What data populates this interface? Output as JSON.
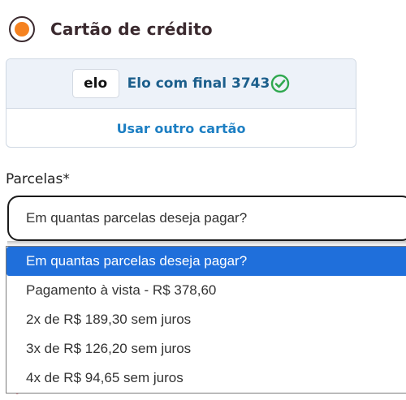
{
  "payment_method": {
    "title": "Cartão de crédito",
    "selected": true
  },
  "saved_card": {
    "brand": "elo",
    "label": "Elo com final 3743",
    "verified_icon": "check-circle-icon"
  },
  "other_card_link": "Usar outro cartão",
  "installments": {
    "label": "Parcelas*",
    "selected_value": "Em quantas parcelas deseja pagar?",
    "options": [
      "Em quantas parcelas deseja pagar?",
      "Pagamento à vista - R$ 378,60",
      "2x de R$ 189,30 sem juros",
      "3x de R$ 126,20 sem juros",
      "4x de R$ 94,65 sem juros"
    ],
    "highlighted_index": 0
  },
  "colors": {
    "accent_orange": "#f58220",
    "link_blue": "#1d7fc3",
    "card_label_blue": "#1c5f8c",
    "selection_blue": "#1f6fdb",
    "check_green": "#2fa84f"
  }
}
